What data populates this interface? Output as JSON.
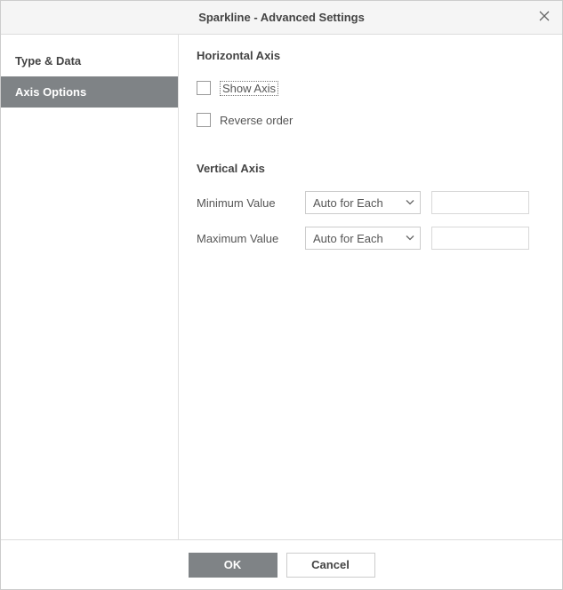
{
  "titlebar": {
    "title": "Sparkline - Advanced Settings"
  },
  "sidebar": {
    "items": [
      {
        "label": "Type & Data",
        "active": false
      },
      {
        "label": "Axis Options",
        "active": true
      }
    ]
  },
  "main": {
    "horizontal_section_title": "Horizontal Axis",
    "show_axis_label": "Show Axis",
    "reverse_order_label": "Reverse order",
    "vertical_section_title": "Vertical Axis",
    "min_label": "Minimum Value",
    "max_label": "Maximum Value",
    "select_options": {
      "min_selected": "Auto for Each",
      "max_selected": "Auto for Each"
    },
    "min_value": "",
    "max_value": ""
  },
  "footer": {
    "ok_label": "OK",
    "cancel_label": "Cancel"
  }
}
